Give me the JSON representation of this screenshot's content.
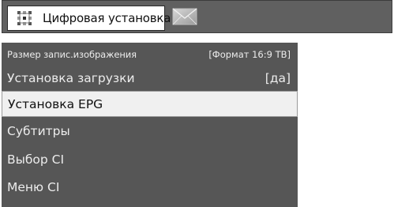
{
  "tabs": {
    "active": {
      "label": "Цифровая установка",
      "icon": "settings-grid-icon"
    },
    "inactive": {
      "icon": "envelope-icon"
    }
  },
  "menu": {
    "selected_index": 2,
    "items": [
      {
        "label": "Размер запис.изображения",
        "value": "[Формат 16:9 ТВ]"
      },
      {
        "label": "Установка загрузки",
        "value": "[да]"
      },
      {
        "label": "Установка EPG",
        "value": ""
      },
      {
        "label": "Субтитры",
        "value": ""
      },
      {
        "label": "Выбор CI",
        "value": ""
      },
      {
        "label": "Меню CI",
        "value": ""
      }
    ]
  },
  "colors": {
    "panel": "#565656",
    "tab_bar": "#606060",
    "selected_row": "#f0f0f0"
  }
}
